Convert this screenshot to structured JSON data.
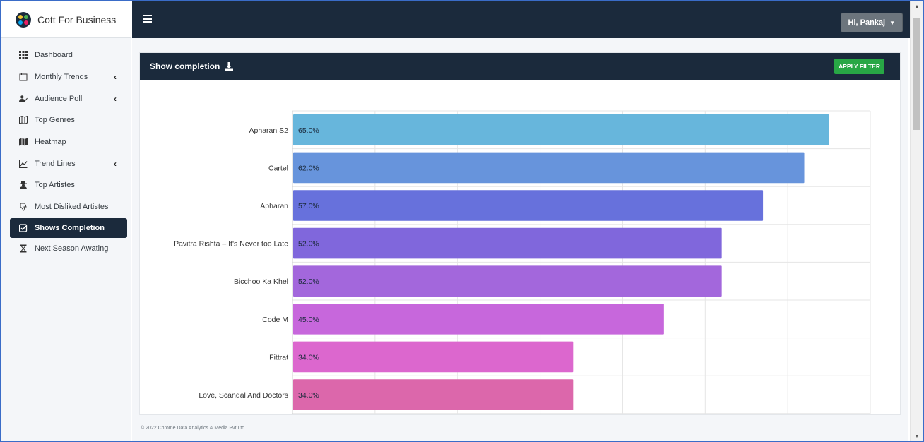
{
  "brand": {
    "title": "Cott For Business"
  },
  "sidebar": {
    "items": [
      {
        "label": "Dashboard",
        "icon": "grid-icon",
        "chevron": false,
        "active": false
      },
      {
        "label": "Monthly Trends",
        "icon": "calendar-icon",
        "chevron": true,
        "active": false
      },
      {
        "label": "Audience Poll",
        "icon": "user-check-icon",
        "chevron": true,
        "active": false
      },
      {
        "label": "Top Genres",
        "icon": "map-outline-icon",
        "chevron": false,
        "active": false
      },
      {
        "label": "Heatmap",
        "icon": "map-icon",
        "chevron": false,
        "active": false
      },
      {
        "label": "Trend Lines",
        "icon": "line-chart-icon",
        "chevron": true,
        "active": false
      },
      {
        "label": "Top Artistes",
        "icon": "user-secret-icon",
        "chevron": false,
        "active": false
      },
      {
        "label": "Most Disliked Artistes",
        "icon": "thumbs-down-icon",
        "chevron": false,
        "active": false
      },
      {
        "label": "Shows Completion",
        "icon": "check-square-icon",
        "chevron": false,
        "active": true
      },
      {
        "label": "Next Season Awating",
        "icon": "hourglass-icon",
        "chevron": false,
        "active": false
      }
    ],
    "chevron_glyph": "‹"
  },
  "topbar": {
    "user_label": "Hi, Pankaj"
  },
  "card": {
    "title": "Show completion",
    "apply_label": "APPLY FILTER"
  },
  "footer": {
    "text": "© 2022 Chrome Data Analytics & Media Pvt Ltd."
  },
  "colors": {
    "dark": "#1b2a3c",
    "green": "#28a745"
  },
  "chart_data": {
    "type": "bar",
    "orientation": "horizontal",
    "categories": [
      "Apharan S2",
      "Cartel",
      "Apharan",
      "Pavitra Rishta – It's Never too Late",
      "Bicchoo Ka Khel",
      "Code M",
      "Fittrat",
      "Love, Scandal And Doctors"
    ],
    "values": [
      65.0,
      62.0,
      57.0,
      52.0,
      52.0,
      45.0,
      34.0,
      34.0
    ],
    "data_labels": [
      "65.0%",
      "62.0%",
      "57.0%",
      "52.0%",
      "52.0%",
      "45.0%",
      "34.0%",
      "34.0%"
    ],
    "colors": [
      "#67b6dc",
      "#6794dc",
      "#6771dc",
      "#8067dc",
      "#a367dc",
      "#c767dc",
      "#dc67ce",
      "#dc67ab"
    ],
    "xlim": [
      0,
      70
    ],
    "grid": true,
    "title": "",
    "xlabel": "",
    "ylabel": ""
  }
}
